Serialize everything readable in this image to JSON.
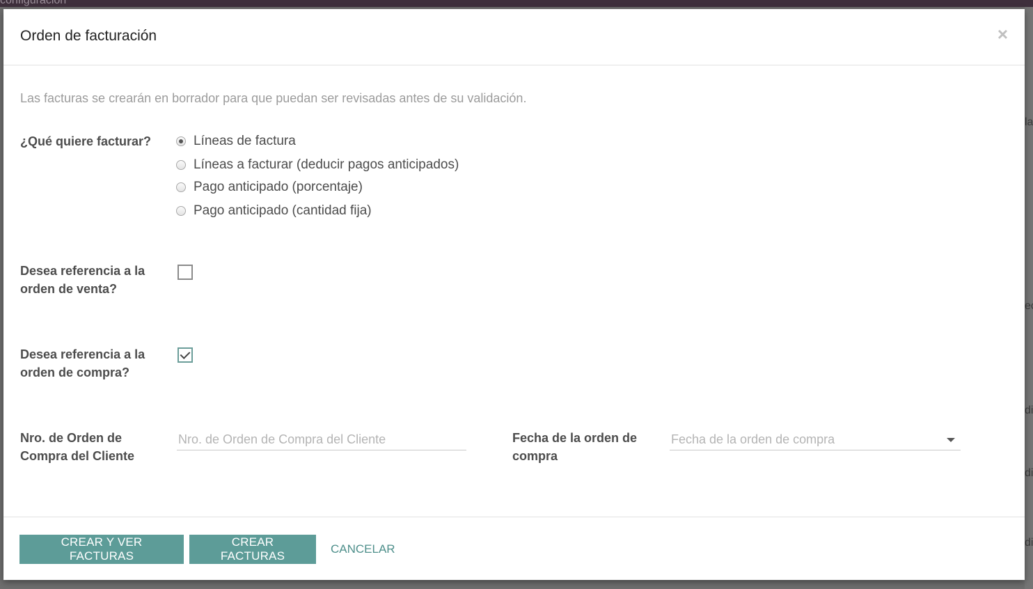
{
  "background": {
    "topbar_text": "configuración",
    "right_fragments": [
      "la",
      "ec",
      "di",
      "di",
      "di"
    ]
  },
  "dialog": {
    "title": "Orden de facturación",
    "close_symbol": "×",
    "intro": "Las facturas se crearán en borrador para que puedan ser revisadas antes de su validación."
  },
  "invoice_method": {
    "label": "¿Qué quiere facturar?",
    "options": [
      {
        "label": "Líneas de factura",
        "checked": true
      },
      {
        "label": "Líneas a facturar (deducir pagos anticipados)",
        "checked": false
      },
      {
        "label": "Pago anticipado (porcentaje)",
        "checked": false
      },
      {
        "label": "Pago anticipado (cantidad fija)",
        "checked": false
      }
    ]
  },
  "ref_sale_order": {
    "label_line1": "Desea referencia a la",
    "label_line2": "orden de venta?",
    "checked": false
  },
  "ref_purchase_order": {
    "label_line1": "Desea referencia a la",
    "label_line2": "orden de compra?",
    "checked": true
  },
  "customer_po_number": {
    "label_line1": "Nro. de Orden de",
    "label_line2": "Compra del Cliente",
    "value": "",
    "placeholder": "Nro. de Orden de Compra del Cliente"
  },
  "purchase_order_date": {
    "label_line1": "Fecha de la orden de",
    "label_line2": "compra",
    "placeholder": "Fecha de la orden de compra"
  },
  "footer": {
    "create_view_label": "CREAR Y VER FACTURAS",
    "create_label": "CREAR FACTURAS",
    "cancel_label": "CANCELAR"
  },
  "colors": {
    "primary": "#5d9c98",
    "link": "#4e8f8b",
    "topbar": "#3e2f3c"
  }
}
